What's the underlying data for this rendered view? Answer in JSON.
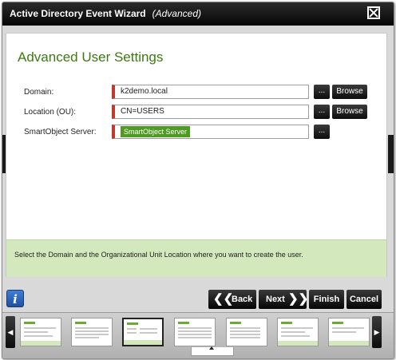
{
  "window": {
    "title": "Active Directory Event Wizard",
    "subtitle": "(Advanced)"
  },
  "page": {
    "heading": "Advanced User Settings"
  },
  "fields": {
    "domain": {
      "label": "Domain:",
      "value": "k2demo.local"
    },
    "location": {
      "label": "Location (OU):",
      "value": "CN=USERS"
    },
    "smartobject": {
      "label": "SmartObject Server:",
      "value": "SmartObject Server"
    }
  },
  "buttons": {
    "ellipsis": "...",
    "browse": "Browse",
    "back": "Back",
    "next": "Next",
    "finish": "Finish",
    "cancel": "Cancel",
    "info": "i"
  },
  "hint": "Select the Domain and the Organizational Unit Location where you want to create the user.",
  "icons": {
    "close": "close-icon",
    "back": "double-chevron-left-icon",
    "next": "double-chevron-right-icon",
    "info": "info-icon"
  },
  "colors": {
    "heading": "#3c7a12",
    "required": "#c0392b",
    "chip": "#4e9a22",
    "hint_bg": "#d4e8be",
    "info": "#2e66bd"
  },
  "thumbnails": {
    "count": 7,
    "active_index": 2
  }
}
